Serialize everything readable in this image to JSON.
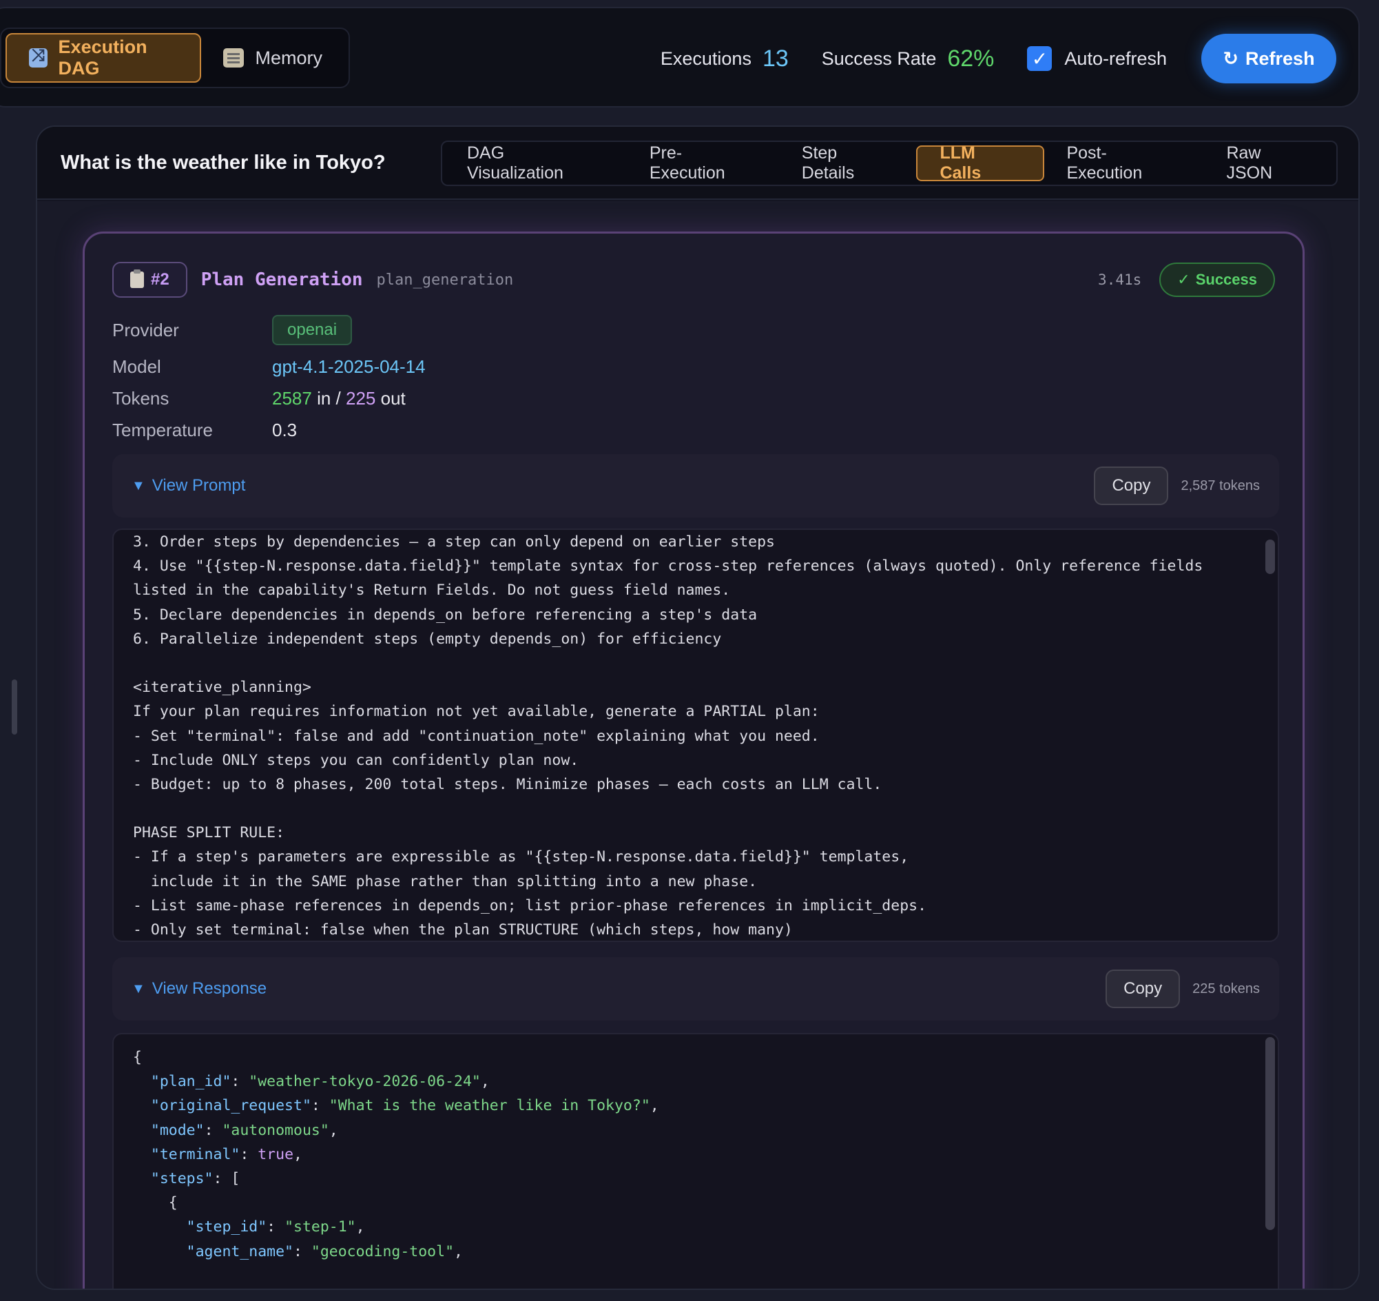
{
  "topbar": {
    "views": [
      {
        "label": "Execution DAG",
        "icon": "shuffle-icon",
        "active": true
      },
      {
        "label": "Memory",
        "icon": "memo-icon",
        "active": false
      }
    ],
    "executions_label": "Executions",
    "executions_value": "13",
    "success_rate_label": "Success Rate",
    "success_rate_value": "62%",
    "auto_refresh_label": "Auto-refresh",
    "auto_refresh_checked": true,
    "refresh_label": "Refresh",
    "refresh_icon": "↻"
  },
  "execution": {
    "query": "What is the weather like in Tokyo?",
    "tabs": [
      {
        "label": "DAG Visualization",
        "active": false
      },
      {
        "label": "Pre-Execution",
        "active": false
      },
      {
        "label": "Step Details",
        "active": false
      },
      {
        "label": "LLM Calls",
        "active": true
      },
      {
        "label": "Post-Execution",
        "active": false
      },
      {
        "label": "Raw JSON",
        "active": false
      }
    ]
  },
  "llm_call": {
    "number": "#2",
    "name": "Plan Generation",
    "id": "plan_generation",
    "duration": "3.41s",
    "status": "Success",
    "status_icon": "✓",
    "provider_label": "Provider",
    "provider": "openai",
    "model_label": "Model",
    "model": "gpt-4.1-2025-04-14",
    "tokens_label": "Tokens",
    "tokens_in": "2587",
    "tokens_in_suffix": "in /",
    "tokens_out": "225",
    "tokens_out_suffix": "out",
    "temperature_label": "Temperature",
    "temperature": "0.3",
    "prompt": {
      "toggle_label": "View Prompt",
      "copy_label": "Copy",
      "token_count": "2,587 tokens",
      "lines": [
        "3. Order steps by dependencies — a step can only depend on earlier steps",
        "4. Use \"{{step-N.response.data.field}}\" template syntax for cross-step references (always quoted). Only reference fields",
        "listed in the capability's Return Fields. Do not guess field names.",
        "5. Declare dependencies in depends_on before referencing a step's data",
        "6. Parallelize independent steps (empty depends_on) for efficiency",
        "",
        "<iterative_planning>",
        "If your plan requires information not yet available, generate a PARTIAL plan:",
        "- Set \"terminal\": false and add \"continuation_note\" explaining what you need.",
        "- Include ONLY steps you can confidently plan now.",
        "- Budget: up to 8 phases, 200 total steps. Minimize phases — each costs an LLM call.",
        "",
        "PHASE SPLIT RULE:",
        "- If a step's parameters are expressible as \"{{step-N.response.data.field}}\" templates,",
        "  include it in the SAME phase rather than splitting into a new phase.",
        "- List same-phase references in depends_on; list prior-phase references in implicit_deps.",
        "- Only set terminal: false when the plan STRUCTURE (which steps, how many)"
      ]
    },
    "response": {
      "toggle_label": "View Response",
      "copy_label": "Copy",
      "token_count": "225 tokens",
      "line1": "{",
      "plan_id_key": "\"plan_id\"",
      "plan_id_val": "\"weather-tokyo-2026-06-24\"",
      "request_key": "\"original_request\"",
      "request_val": "\"What is the weather like in Tokyo?\"",
      "mode_key": "\"mode\"",
      "mode_val": "\"autonomous\"",
      "terminal_key": "\"terminal\"",
      "terminal_val": "true",
      "steps_key": "\"steps\"",
      "step_open": "{",
      "step_id_key": "\"step_id\"",
      "step_id_val": "\"step-1\"",
      "agent_key": "\"agent_name\"",
      "agent_val": "\"geocoding-tool\""
    }
  }
}
